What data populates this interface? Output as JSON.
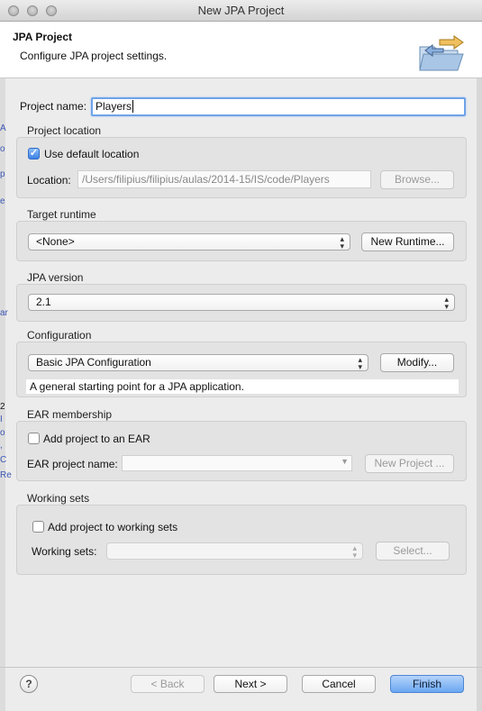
{
  "window": {
    "title": "New JPA Project"
  },
  "header": {
    "title": "JPA Project",
    "subtitle": "Configure JPA project settings.",
    "icon": "folder-wizard-icon"
  },
  "project_name": {
    "label": "Project name:",
    "value": "Players"
  },
  "project_location": {
    "title": "Project location",
    "use_default_label": "Use default location",
    "use_default_checked": true,
    "location_label": "Location:",
    "location_value": "/Users/filipius/filipius/aulas/2014-15/IS/code/Players",
    "browse_label": "Browse..."
  },
  "target_runtime": {
    "title": "Target runtime",
    "selected": "<None>",
    "new_runtime_label": "New Runtime..."
  },
  "jpa_version": {
    "title": "JPA version",
    "selected": "2.1"
  },
  "configuration": {
    "title": "Configuration",
    "selected": "Basic JPA Configuration",
    "modify_label": "Modify...",
    "description": "A general starting point for a JPA application."
  },
  "ear": {
    "title": "EAR membership",
    "add_label": "Add project to an EAR",
    "add_checked": false,
    "name_label": "EAR project name:",
    "name_value": "",
    "new_project_label": "New Project ..."
  },
  "working_sets": {
    "title": "Working sets",
    "add_label": "Add project to working sets",
    "add_checked": false,
    "sets_label": "Working sets:",
    "sets_value": "",
    "select_label": "Select..."
  },
  "footer": {
    "help_glyph": "?",
    "back_label": "< Back",
    "next_label": "Next >",
    "cancel_label": "Cancel",
    "finish_label": "Finish"
  },
  "background_fragments": [
    "A",
    "o",
    "p",
    "e",
    "ar",
    "2",
    "I",
    "o",
    ",",
    "C",
    "Re"
  ],
  "colors": {
    "accent": "#6aa7f1",
    "focus": "#6fa3e8",
    "window_bg": "#ececec"
  }
}
